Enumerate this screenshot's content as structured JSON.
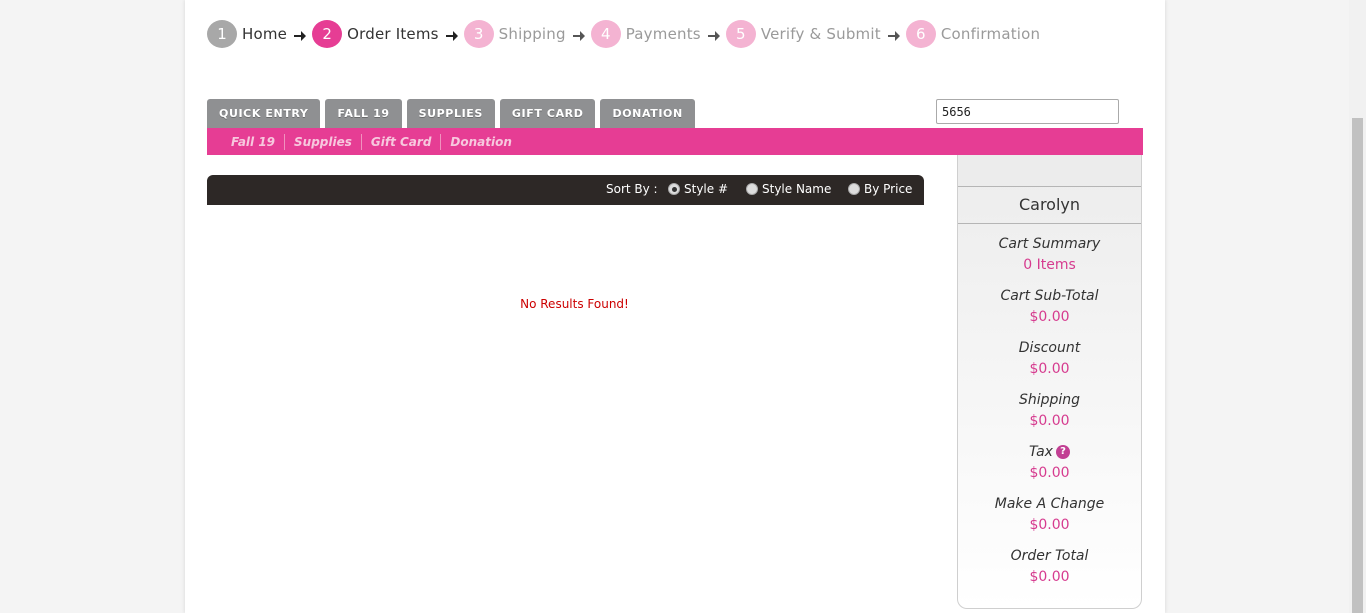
{
  "steps": [
    {
      "num": "1",
      "label": "Home"
    },
    {
      "num": "2",
      "label": "Order Items"
    },
    {
      "num": "3",
      "label": "Shipping"
    },
    {
      "num": "4",
      "label": "Payments"
    },
    {
      "num": "5",
      "label": "Verify & Submit"
    },
    {
      "num": "6",
      "label": "Confirmation"
    }
  ],
  "tabs": [
    "QUICK ENTRY",
    "FALL 19",
    "SUPPLIES",
    "GIFT CARD",
    "DONATION"
  ],
  "search": {
    "value": "5656"
  },
  "subnav": [
    "Fall 19",
    "Supplies",
    "Gift Card",
    "Donation"
  ],
  "sort": {
    "label": "Sort By :",
    "options": [
      "Style #",
      "Style Name",
      "By Price"
    ],
    "selected": "Style #"
  },
  "results": {
    "message": "No Results Found!"
  },
  "cart": {
    "customer": "Carolyn",
    "rows": [
      {
        "label": "Cart Summary",
        "value": "0 Items"
      },
      {
        "label": "Cart Sub-Total",
        "value": "$0.00"
      },
      {
        "label": "Discount",
        "value": "$0.00"
      },
      {
        "label": "Shipping",
        "value": "$0.00"
      },
      {
        "label": "Tax",
        "value": "$0.00"
      },
      {
        "label": "Make A Change",
        "value": "$0.00"
      },
      {
        "label": "Order Total",
        "value": "$0.00"
      }
    ],
    "tax_help": "?"
  },
  "colors": {
    "accent": "#e63d94",
    "value": "#d63b8f",
    "error": "#cc0000"
  }
}
